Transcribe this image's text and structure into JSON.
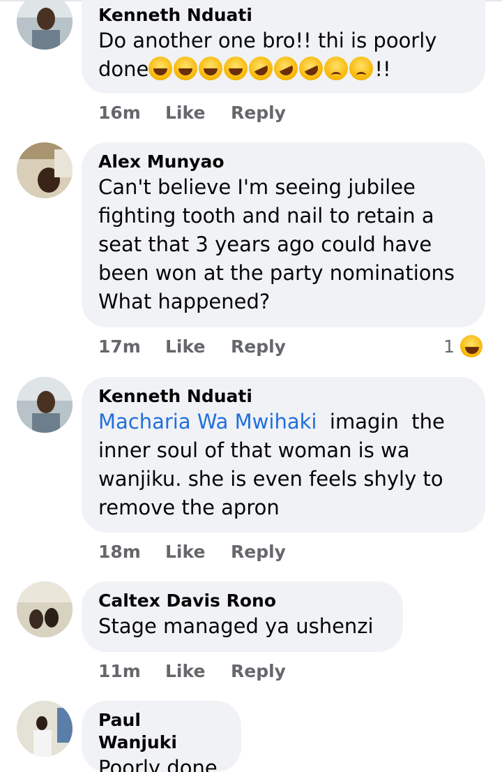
{
  "actions": {
    "like_label": "Like",
    "reply_label": "Reply"
  },
  "comments": [
    {
      "author": "Kenneth Nduati",
      "text_line1": "Do another one bro!! thi is poorly",
      "text_line2_prefix": "done",
      "text_line2_suffix": "!!",
      "time": "16m"
    },
    {
      "author": "Alex Munyao",
      "lines": [
        "Can't believe I'm seeing jubilee",
        "fighting tooth and nail to retain a",
        "seat that 3 years ago could have",
        "been won at the party nominations",
        "What happened?"
      ],
      "time": "17m",
      "reaction_count": "1"
    },
    {
      "author": "Kenneth Nduati",
      "mention": "Macharia Wa Mwihaki",
      "line1_rest": "  imagin  the",
      "lines": [
        "inner soul of that woman is wa",
        "wanjiku. she is even feels shyly to",
        "remove the apron"
      ],
      "time": "18m"
    },
    {
      "author": "Caltex Davis Rono",
      "text": "Stage managed ya ushenzi",
      "time": "11m"
    },
    {
      "author": "Paul Wanjuki",
      "text": "Poorly done"
    }
  ]
}
